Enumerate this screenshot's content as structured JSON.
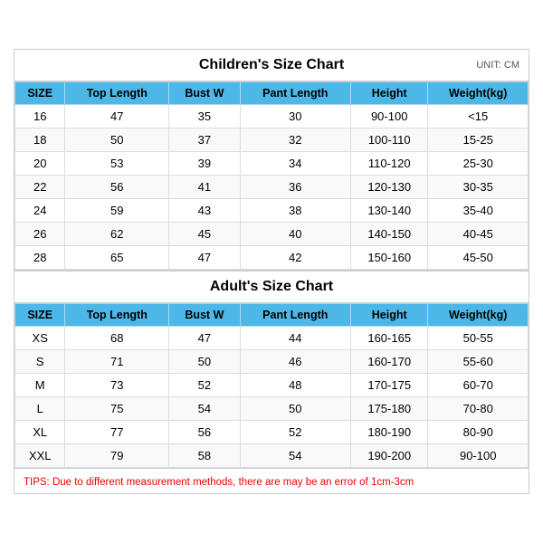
{
  "children_chart": {
    "title": "Children's Size Chart",
    "unit": "UNIT: CM",
    "headers": [
      "SIZE",
      "Top Length",
      "Bust W",
      "Pant Length",
      "Height",
      "Weight(kg)"
    ],
    "rows": [
      [
        "16",
        "47",
        "35",
        "30",
        "90-100",
        "<15"
      ],
      [
        "18",
        "50",
        "37",
        "32",
        "100-110",
        "15-25"
      ],
      [
        "20",
        "53",
        "39",
        "34",
        "110-120",
        "25-30"
      ],
      [
        "22",
        "56",
        "41",
        "36",
        "120-130",
        "30-35"
      ],
      [
        "24",
        "59",
        "43",
        "38",
        "130-140",
        "35-40"
      ],
      [
        "26",
        "62",
        "45",
        "40",
        "140-150",
        "40-45"
      ],
      [
        "28",
        "65",
        "47",
        "42",
        "150-160",
        "45-50"
      ]
    ]
  },
  "adult_chart": {
    "title": "Adult's Size Chart",
    "headers": [
      "SIZE",
      "Top Length",
      "Bust W",
      "Pant Length",
      "Height",
      "Weight(kg)"
    ],
    "rows": [
      [
        "XS",
        "68",
        "47",
        "44",
        "160-165",
        "50-55"
      ],
      [
        "S",
        "71",
        "50",
        "46",
        "160-170",
        "55-60"
      ],
      [
        "M",
        "73",
        "52",
        "48",
        "170-175",
        "60-70"
      ],
      [
        "L",
        "75",
        "54",
        "50",
        "175-180",
        "70-80"
      ],
      [
        "XL",
        "77",
        "56",
        "52",
        "180-190",
        "80-90"
      ],
      [
        "XXL",
        "79",
        "58",
        "54",
        "190-200",
        "90-100"
      ]
    ]
  },
  "tips": "TIPS: Due to different measurement methods, there are may be an error of 1cm-3cm"
}
